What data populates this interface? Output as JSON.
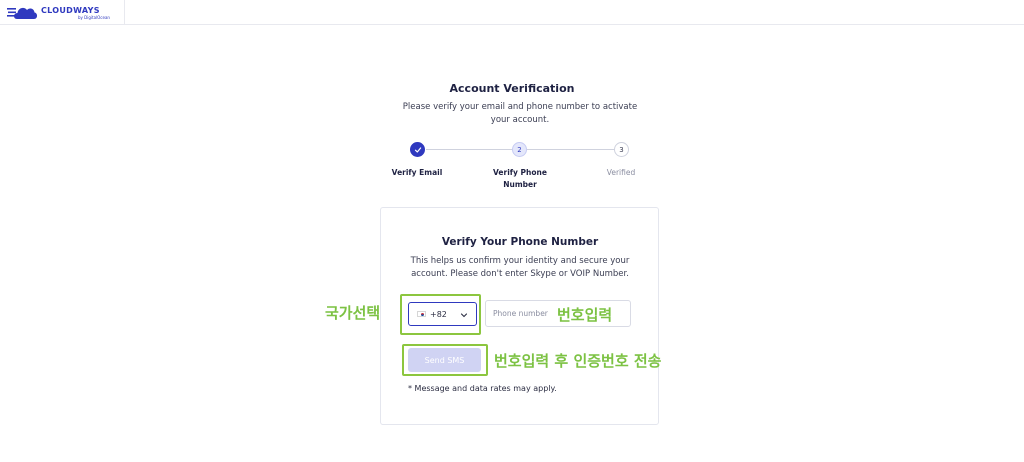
{
  "header": {
    "logo_text": "CLOUDWAYS",
    "logo_subtext": "by DigitalOcean",
    "brand_color": "#2f39bf"
  },
  "verification": {
    "title": "Account Verification",
    "subtitle": "Please verify your email and phone number to activate your account.",
    "steps": [
      {
        "number": "1",
        "label": "Verify Email",
        "state": "completed",
        "icon": "check-icon"
      },
      {
        "number": "2",
        "label": "Verify Phone Number",
        "state": "active"
      },
      {
        "number": "3",
        "label": "Verified",
        "state": "pending"
      }
    ]
  },
  "phone_card": {
    "title": "Verify Your Phone Number",
    "description": "This helps us confirm your identity and secure your account. Please don't enter Skype or VOIP Number.",
    "country_code": "+82",
    "country_flag": "south-korea-flag-icon",
    "phone_placeholder": "Phone number",
    "send_button": "Send SMS",
    "disclaimer": "* Message and data rates may apply."
  },
  "annotations": {
    "country_select_note": "국가선택",
    "phone_input_note": "번호입력",
    "send_note": "번호입력 후 인증번호 전송",
    "highlight_color": "#8cc63f"
  }
}
